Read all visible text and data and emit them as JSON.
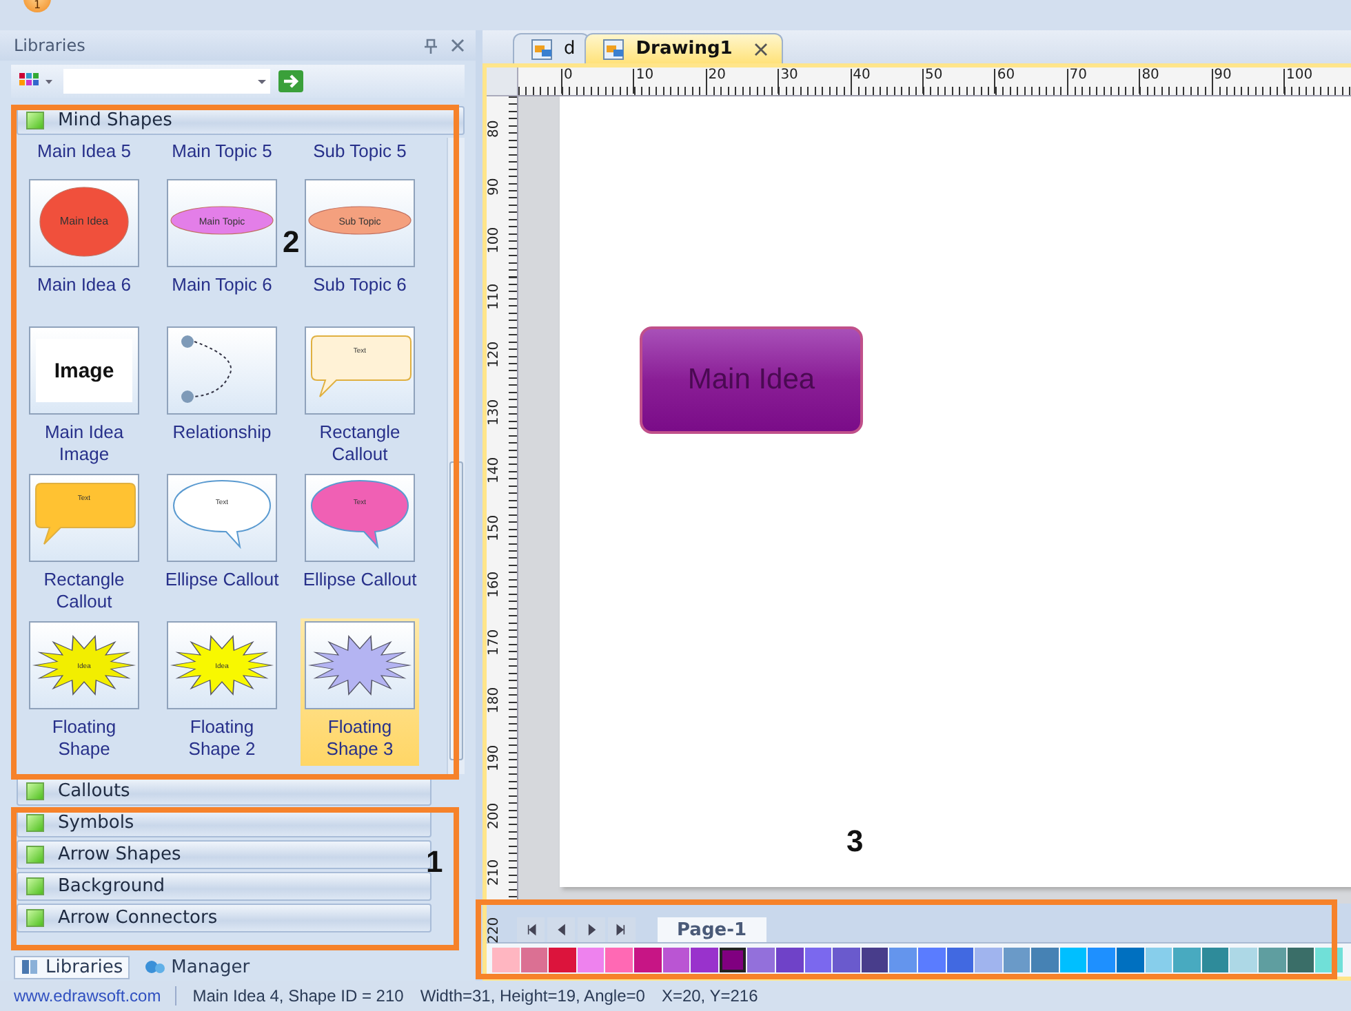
{
  "app_badge": "1",
  "libraries_panel": {
    "title": "Libraries",
    "groups": [
      {
        "label": "Mind Shapes",
        "expanded": true,
        "shapes": [
          {
            "kind": "cut",
            "label": "Main Idea 5",
            "selected": false
          },
          {
            "kind": "cut",
            "label": "Main Topic 5",
            "selected": false
          },
          {
            "kind": "cut",
            "label": "Sub Topic 5",
            "selected": false
          },
          {
            "kind": "ellipse",
            "label": "Main Idea 6",
            "text": "Main Idea",
            "color": "#f0503c",
            "selected": false
          },
          {
            "kind": "ellipse",
            "label": "Main Topic 6",
            "text": "Main Topic",
            "color": "#e37ee8",
            "selected": false
          },
          {
            "kind": "ellipse",
            "label": "Sub Topic 6",
            "text": "Sub Topic",
            "color": "#f4a07e",
            "selected": false
          },
          {
            "kind": "image",
            "label": "Main Idea Image",
            "text": "Image",
            "selected": false
          },
          {
            "kind": "relationship",
            "label": "Relationship",
            "selected": false
          },
          {
            "kind": "rect-callout",
            "label": "Rectangle Callout",
            "text": "Text",
            "color": "#fff2d6",
            "selected": false
          },
          {
            "kind": "rect-callout",
            "label": "Rectangle Callout",
            "text": "Text",
            "color": "#ffc232",
            "selected": false
          },
          {
            "kind": "ellipse-callout",
            "label": "Ellipse Callout",
            "text": "Text",
            "color": "#ffffff",
            "selected": false
          },
          {
            "kind": "ellipse-callout",
            "label": "Ellipse Callout",
            "text": "Text",
            "color": "#f060b4",
            "selected": false
          },
          {
            "kind": "burst",
            "label": "Floating Shape",
            "text": "Idea",
            "color": "#f2ee00",
            "selected": false
          },
          {
            "kind": "burst",
            "label": "Floating Shape 2",
            "text": "Idea",
            "color": "#f8f800",
            "selected": false
          },
          {
            "kind": "burst",
            "label": "Floating Shape 3",
            "color": "#b4b4f2",
            "selected": true
          }
        ]
      },
      {
        "label": "Callouts",
        "expanded": false
      },
      {
        "label": "Symbols",
        "expanded": false
      },
      {
        "label": "Arrow Shapes",
        "expanded": false
      },
      {
        "label": "Background",
        "expanded": false
      },
      {
        "label": "Arrow Connectors",
        "expanded": false
      }
    ]
  },
  "panel_tabs": [
    {
      "label": "Libraries",
      "selected": true
    },
    {
      "label": "Manager",
      "selected": false
    }
  ],
  "doc_tabs": [
    {
      "label": "d",
      "selected": false
    },
    {
      "label": "Drawing1",
      "selected": true
    }
  ],
  "ruler": {
    "h_labels": [
      "0",
      "10",
      "20",
      "30",
      "40",
      "50",
      "60",
      "70",
      "80",
      "90",
      "100"
    ],
    "v_labels": [
      "80",
      "90",
      "100",
      "110",
      "120",
      "130",
      "140",
      "150",
      "160",
      "170",
      "180",
      "190",
      "200",
      "210",
      "220"
    ]
  },
  "canvas": {
    "shape_text": "Main Idea"
  },
  "page_tabs": [
    {
      "label": "Page-1",
      "selected": true
    }
  ],
  "palette": [
    {
      "color": "#ffb6c1",
      "selected": false
    },
    {
      "color": "#db7093",
      "selected": false
    },
    {
      "color": "#dc143c",
      "selected": false
    },
    {
      "color": "#ee82ee",
      "selected": false
    },
    {
      "color": "#ff69b4",
      "selected": false
    },
    {
      "color": "#c71585",
      "selected": false
    },
    {
      "color": "#ba55d3",
      "selected": false
    },
    {
      "color": "#9932cc",
      "selected": false
    },
    {
      "color": "#800080",
      "selected": true
    },
    {
      "color": "#9370db",
      "selected": false
    },
    {
      "color": "#6f42c8",
      "selected": false
    },
    {
      "color": "#7b68ee",
      "selected": false
    },
    {
      "color": "#6a5acd",
      "selected": false
    },
    {
      "color": "#483d8b",
      "selected": false
    },
    {
      "color": "#6495ed",
      "selected": false
    },
    {
      "color": "#5a7cff",
      "selected": false
    },
    {
      "color": "#4169e1",
      "selected": false
    },
    {
      "color": "#a0b4ee",
      "selected": false
    },
    {
      "color": "#6a9ac8",
      "selected": false
    },
    {
      "color": "#4682b4",
      "selected": false
    },
    {
      "color": "#00bfff",
      "selected": false
    },
    {
      "color": "#1e90ff",
      "selected": false
    },
    {
      "color": "#0070c0",
      "selected": false
    },
    {
      "color": "#87ceeb",
      "selected": false
    },
    {
      "color": "#48aac0",
      "selected": false
    },
    {
      "color": "#2e8b9a",
      "selected": false
    },
    {
      "color": "#add8e6",
      "selected": false
    },
    {
      "color": "#5f9ea0",
      "selected": false
    },
    {
      "color": "#3a6e68",
      "selected": false
    },
    {
      "color": "#70e0d8",
      "selected": false
    }
  ],
  "status_bar": {
    "website": "www.edrawsoft.com",
    "shape": "Main Idea 4, Shape ID = 210",
    "size": "Width=31, Height=19, Angle=0",
    "position": "X=20, Y=216"
  },
  "annotations": [
    {
      "label": "2"
    },
    {
      "label": "1"
    },
    {
      "label": "3"
    }
  ]
}
